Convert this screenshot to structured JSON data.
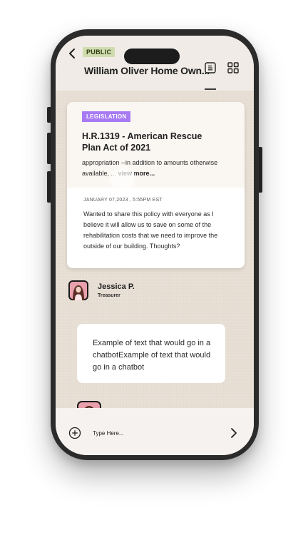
{
  "header": {
    "badge": "PUBLIC",
    "title": "William Oliver Home Own...",
    "icons": [
      "chevron-left-icon",
      "document-icon",
      "grid-icon"
    ]
  },
  "post": {
    "tag": "LEGISLATION",
    "bill_title": "H.R.1319 - American Rescue Plan Act of 2021",
    "bill_excerpt": "appropriation --in addition to amounts otherwise available, ...",
    "view_more": "view more...",
    "date": "JANUARY 07,2023 , 5:55PM EST",
    "body": "Wanted to share this policy with everyone  as I believe it will allow us to save on some of the rehabilitation costs that we need to improve the outside of our building. Thoughts?"
  },
  "author": {
    "name": "Jessica P.",
    "role": "Treasurer"
  },
  "message": {
    "text": "Example of text that would go in a chatbotExample of text that would go in a chatbot"
  },
  "composer": {
    "placeholder": "Type Here...",
    "icons": [
      "plus-circle-icon",
      "chevron-right-icon"
    ]
  },
  "colors": {
    "public_badge": "#cfdcae",
    "legislation_badge": "#a77af3",
    "chat_background": "#e6ddd2",
    "avatar_accent": "#e8a0ad"
  }
}
